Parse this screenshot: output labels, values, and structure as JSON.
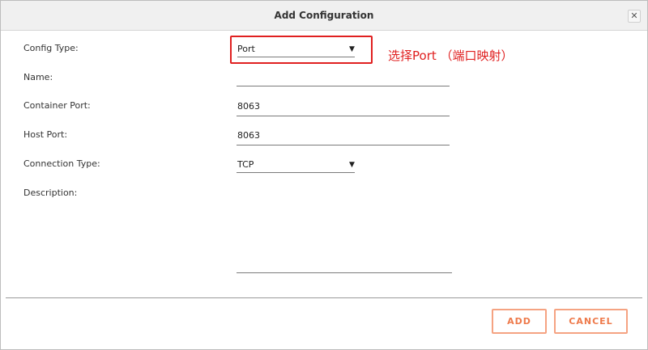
{
  "dialog": {
    "title": "Add Configuration",
    "close_symbol": "✕"
  },
  "form": {
    "config_type": {
      "label": "Config Type:",
      "value": "Port"
    },
    "name": {
      "label": "Name:",
      "value": ""
    },
    "container_port": {
      "label": "Container Port:",
      "value": "8063"
    },
    "host_port": {
      "label": "Host Port:",
      "value": "8063"
    },
    "connection_type": {
      "label": "Connection Type:",
      "value": "TCP"
    },
    "description": {
      "label": "Description:",
      "value": ""
    }
  },
  "annotation": {
    "text": "选择Port （端口映射）"
  },
  "buttons": {
    "add": "ADD",
    "cancel": "CANCEL"
  },
  "icons": {
    "dropdown": "▼"
  },
  "colors": {
    "accent": "#ee7a4b",
    "annotation": "#e02020"
  }
}
